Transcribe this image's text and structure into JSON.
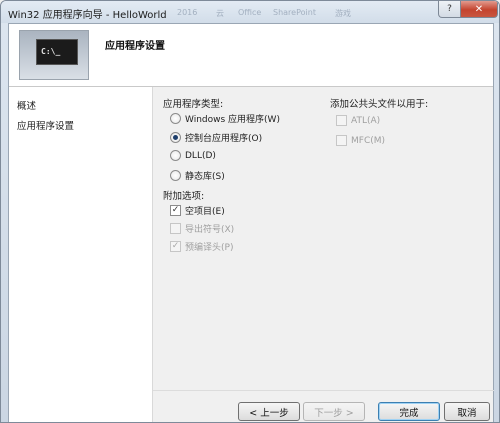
{
  "window": {
    "title": "Win32 应用程序向导 - HelloWorld",
    "background_tabs": [
      "2016",
      "云",
      "Office",
      "SharePoint",
      "游戏"
    ],
    "help_label": "?",
    "close_label": "✕"
  },
  "header": {
    "console_text": "C:\\_",
    "title": "应用程序设置"
  },
  "nav": {
    "items": [
      {
        "label": "概述"
      },
      {
        "label": "应用程序设置"
      }
    ]
  },
  "app_type": {
    "label": "应用程序类型:",
    "options": [
      {
        "label": "Windows 应用程序(W)",
        "selected": false
      },
      {
        "label": "控制台应用程序(O)",
        "selected": true
      },
      {
        "label": "DLL(D)",
        "selected": false
      },
      {
        "label": "静态库(S)",
        "selected": false
      }
    ]
  },
  "additional": {
    "label": "附加选项:",
    "options": [
      {
        "label": "空项目(E)",
        "checked": true,
        "enabled": true
      },
      {
        "label": "导出符号(X)",
        "checked": false,
        "enabled": false
      },
      {
        "label": "预编译头(P)",
        "checked": true,
        "enabled": false
      }
    ]
  },
  "headers": {
    "label": "添加公共头文件以用于:",
    "options": [
      {
        "label": "ATL(A)",
        "checked": false,
        "enabled": false
      },
      {
        "label": "MFC(M)",
        "checked": false,
        "enabled": false
      }
    ]
  },
  "buttons": {
    "back": "< 上一步",
    "next": "下一步 >",
    "finish": "完成",
    "cancel": "取消"
  },
  "colors": {
    "radio_dot": "#1d3e6b",
    "close_button": "#c4442f",
    "panel_bg": "#f0f0f0"
  }
}
